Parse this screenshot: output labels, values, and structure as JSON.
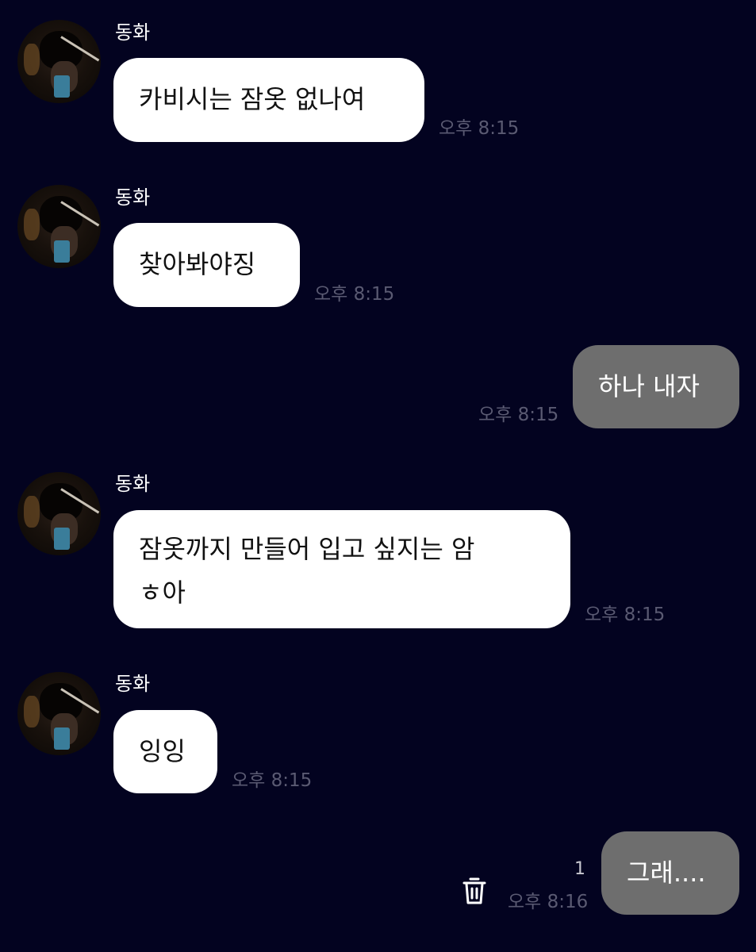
{
  "messages": [
    {
      "sender": "동화",
      "text": "카비시는 잠옷 없나여",
      "time": "오후 8:15"
    },
    {
      "sender": "동화",
      "text": "찾아봐야징",
      "time": "오후 8:15"
    },
    {
      "text": "하나 내자",
      "time": "오후 8:15"
    },
    {
      "sender": "동화",
      "text_line1": "잠옷까지 만들어 입고 싶지는 암",
      "text_line2": "ㅎ아",
      "time": "오후 8:15"
    },
    {
      "sender": "동화",
      "text": "잉잉",
      "time": "오후 8:15"
    },
    {
      "text": "그래....",
      "time": "오후 8:16",
      "unread_count": "1",
      "icon": "trash-icon"
    }
  ],
  "colors": {
    "background": "#030320",
    "incoming_bubble": "#ffffff",
    "outgoing_bubble": "#6e6e6e",
    "timestamp": "#5a5a72"
  }
}
